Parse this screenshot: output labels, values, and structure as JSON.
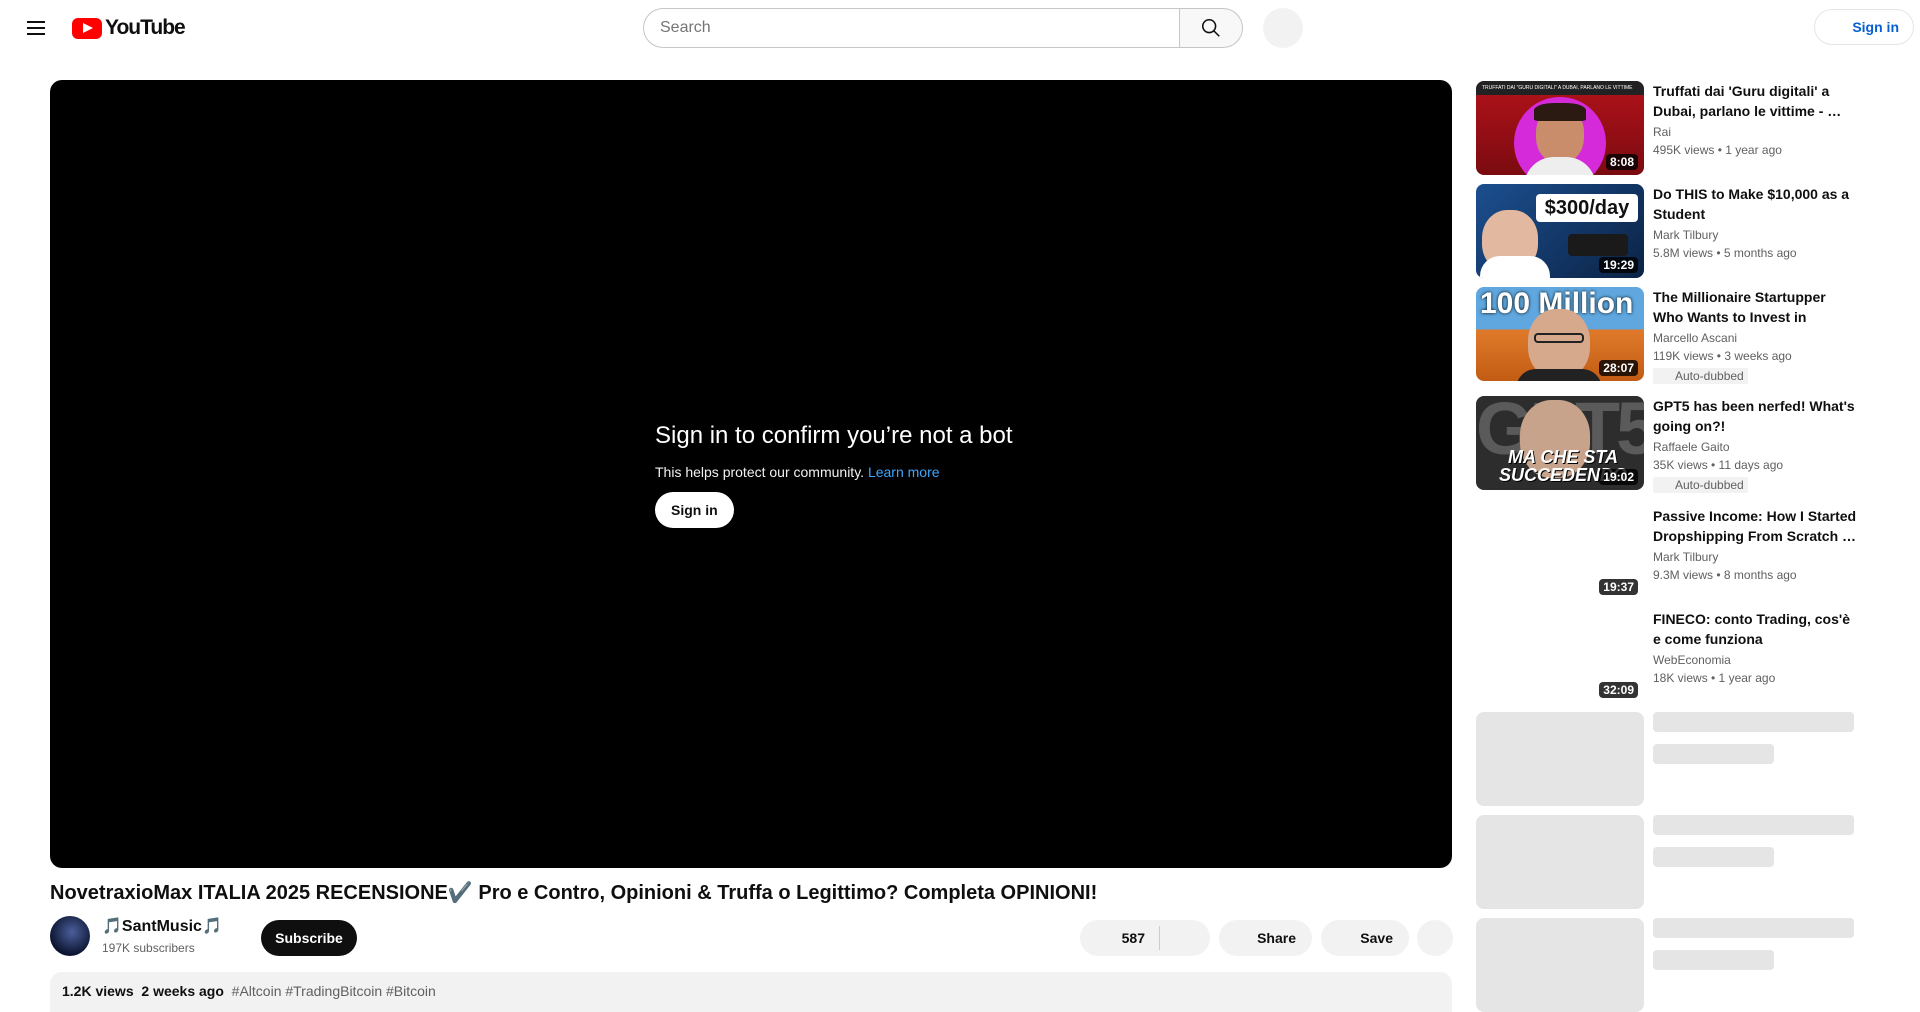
{
  "header": {
    "logo_text": "YouTube",
    "search_placeholder": "Search",
    "sign_in": "Sign in"
  },
  "player": {
    "title": "Sign in to confirm you’re not a bot",
    "subtitle": "This helps protect our community.",
    "learn_more": "Learn more",
    "sign_in_button": "Sign in"
  },
  "video": {
    "title": "NovetraxioMax ITALIA 2025 RECENSIONE✔️ Pro e Contro, Opinioni & Truffa o Legittimo? Completa OPINIONI!",
    "channel": "🎵SantMusic🎵",
    "subscribers": "197K subscribers",
    "subscribe": "Subscribe",
    "likes": "587",
    "share": "Share",
    "save": "Save",
    "views": "1.2K views",
    "date": "2 weeks ago",
    "tags": "#Altcoin #TradingBitcoin #Bitcoin"
  },
  "recommendations": [
    {
      "title": "Truffati dai 'Guru digitali' a Dubai, parlano le vittime - …",
      "channel": "Rai",
      "stats": "495K views • 1 year ago",
      "duration": "8:08",
      "badge": ""
    },
    {
      "title": "Do THIS to Make $10,000 as a Student",
      "channel": "Mark Tilbury",
      "stats": "5.8M views • 5 months ago",
      "duration": "19:29",
      "badge": ""
    },
    {
      "title": "The Millionaire Startupper Who Wants to Invest in CAMPSITES…",
      "channel": "Marcello Ascani",
      "stats": "119K views • 3 weeks ago",
      "duration": "28:07",
      "badge": "Auto-dubbed"
    },
    {
      "title": "GPT5 has been nerfed! What's going on?!",
      "channel": "Raffaele Gaito",
      "stats": "35K views • 11 days ago",
      "duration": "19:02",
      "badge": "Auto-dubbed"
    },
    {
      "title": "Passive Income: How I Started Dropshipping From Scratch …",
      "channel": "Mark Tilbury",
      "stats": "9.3M views • 8 months ago",
      "duration": "19:37",
      "badge": ""
    },
    {
      "title": "FINECO: conto Trading, cos'è e come funziona",
      "channel": "WebEconomia",
      "stats": "18K views • 1 year ago",
      "duration": "32:09",
      "badge": ""
    }
  ],
  "thumb_text": {
    "t1_top": "TRUFFATI DAI \"GURU DIGITALI\" A DUBAI, PARLANO LE VITTIME",
    "t2": "$300/day",
    "t3": "100 Million",
    "t4_big": "GPT5",
    "t4_caption": "MA CHE STA SUCCEDENDO"
  }
}
